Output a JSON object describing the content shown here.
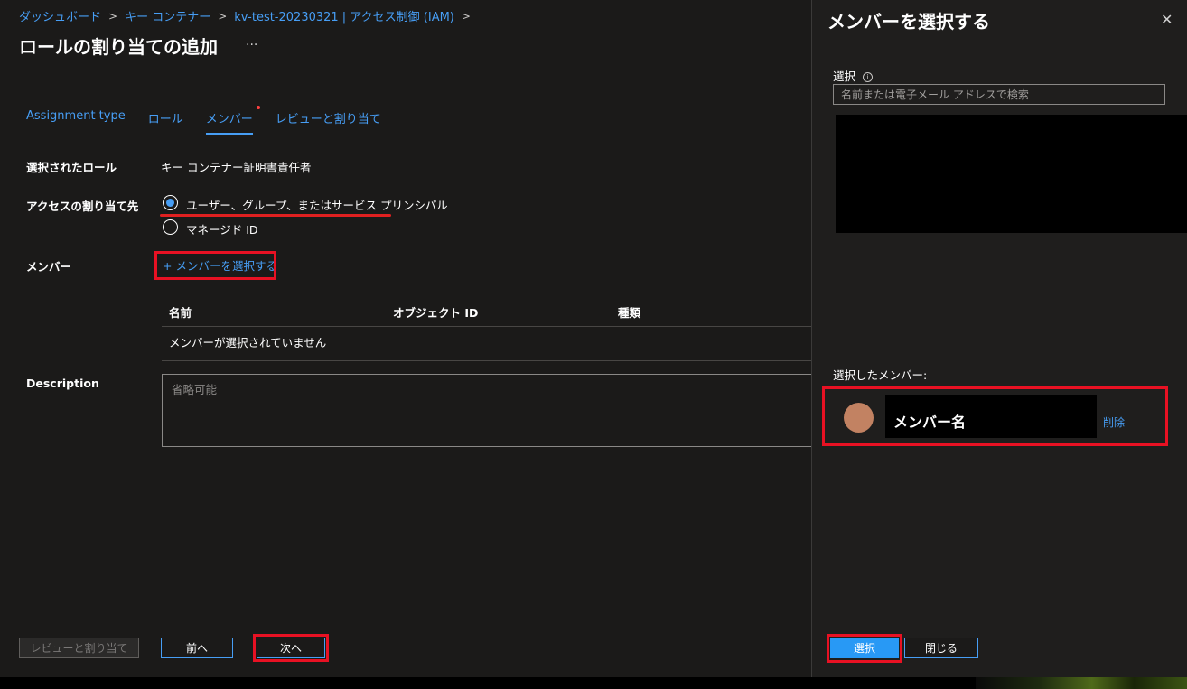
{
  "breadcrumb": {
    "items": [
      "ダッシュボード",
      "キー コンテナー",
      "kv-test-20230321 | アクセス制御 (IAM)"
    ],
    "separator": ">"
  },
  "page": {
    "title": "ロールの割り当ての追加",
    "more_label": "..."
  },
  "tabs": [
    {
      "label": "Assignment type"
    },
    {
      "label": "ロール"
    },
    {
      "label": "メンバー",
      "active": true,
      "required": true
    },
    {
      "label": "レビューと割り当て"
    }
  ],
  "form": {
    "selected_role_label": "選択されたロール",
    "selected_role_value": "キー コンテナー証明書責任者",
    "access_label": "アクセスの割り当て先",
    "access_options": [
      {
        "label": "ユーザー、グループ、またはサービス プリンシパル",
        "checked": true
      },
      {
        "label": "マネージド ID",
        "checked": false
      }
    ],
    "members_label": "メンバー",
    "add_members_label": "メンバーを選択する",
    "table": {
      "headers": [
        "名前",
        "オブジェクト ID",
        "種類"
      ],
      "empty_text": "メンバーが選択されていません"
    },
    "description_label": "Description",
    "description_placeholder": "省略可能"
  },
  "footer": {
    "review_label": "レビューと割り当て",
    "prev_label": "前へ",
    "next_label": "次へ"
  },
  "panel": {
    "title": "メンバーを選択する",
    "close_label": "✕",
    "select_label": "選択",
    "info_icon": "i",
    "search_placeholder": "名前または電子メール アドレスで検索",
    "selected_members_label": "選択したメンバー:",
    "member": {
      "name": "メンバー名",
      "remove_label": "削除"
    },
    "select_button_label": "選択",
    "close_button_label": "閉じる"
  },
  "colors": {
    "accent": "#479ef5",
    "primary_button": "#2899f5",
    "highlight_red": "#e81123",
    "background": "#1b1a19",
    "avatar": "#c28262"
  }
}
